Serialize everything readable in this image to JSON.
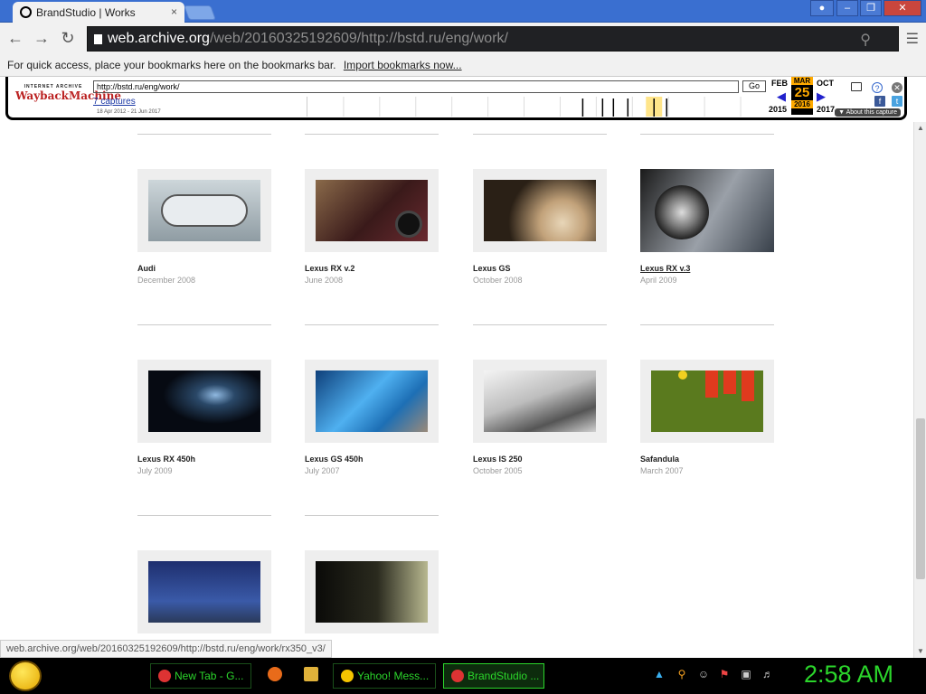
{
  "browser": {
    "tab_title": "BrandStudio | Works",
    "tab_close": "×",
    "url_domain": "web.archive.org",
    "url_rest": "/web/20160325192609/http://bstd.ru/eng/work/",
    "bookmarks_message": "For quick access, place your bookmarks here on the bookmarks bar.",
    "bookmarks_link": "Import bookmarks now...",
    "status_url": "web.archive.org/web/20160325192609/http://bstd.ru/eng/work/rx350_v3/"
  },
  "wayback": {
    "logo_top": "INTERNET ARCHIVE",
    "logo_main": "WaybackMachine",
    "url_value": "http://bstd.ru/eng/work/",
    "go_label": "Go",
    "captures_link": "7 captures",
    "capture_range": "18 Apr 2012 - 21 Jun 2017",
    "prev_month": "FEB",
    "cur_month": "MAR",
    "next_month": "OCT",
    "cur_day": "25",
    "prev_year": "2015",
    "cur_year": "2016",
    "next_year": "2017",
    "about_label": "▼ About this capture"
  },
  "works": [
    {
      "name": "Audi",
      "date": "December 2008",
      "color": "#b8c2c8"
    },
    {
      "name": "Lexus RX v.2",
      "date": "June 2008",
      "color": "#4a2a22"
    },
    {
      "name": "Lexus GS",
      "date": "October 2008",
      "color": "#5a4a36"
    },
    {
      "name": "Lexus RX v.3",
      "date": "April 2009",
      "color": "#6d7280",
      "hovered": true
    },
    {
      "name": "Lexus RX 450h",
      "date": "July 2009",
      "color": "#1c2a3c"
    },
    {
      "name": "Lexus GS 450h",
      "date": "July 2007",
      "color": "#2f7fbf"
    },
    {
      "name": "Lexus IS 250",
      "date": "October 2005",
      "color": "#a9a9a9"
    },
    {
      "name": "Safandula",
      "date": "March 2007",
      "color": "#5a7a1e"
    },
    {
      "name": "",
      "date": "",
      "color": "#2a3e7a"
    },
    {
      "name": "",
      "date": "",
      "color": "#2a2a22"
    }
  ],
  "taskbar": {
    "tasks": [
      {
        "label": "New Tab - G...",
        "icon_color": "#d33"
      },
      {
        "label": "Yahoo! Mess...",
        "icon_color": "#f5c400"
      },
      {
        "label": "BrandStudio ...",
        "icon_color": "#d33"
      }
    ],
    "clock": "2:58 AM"
  }
}
